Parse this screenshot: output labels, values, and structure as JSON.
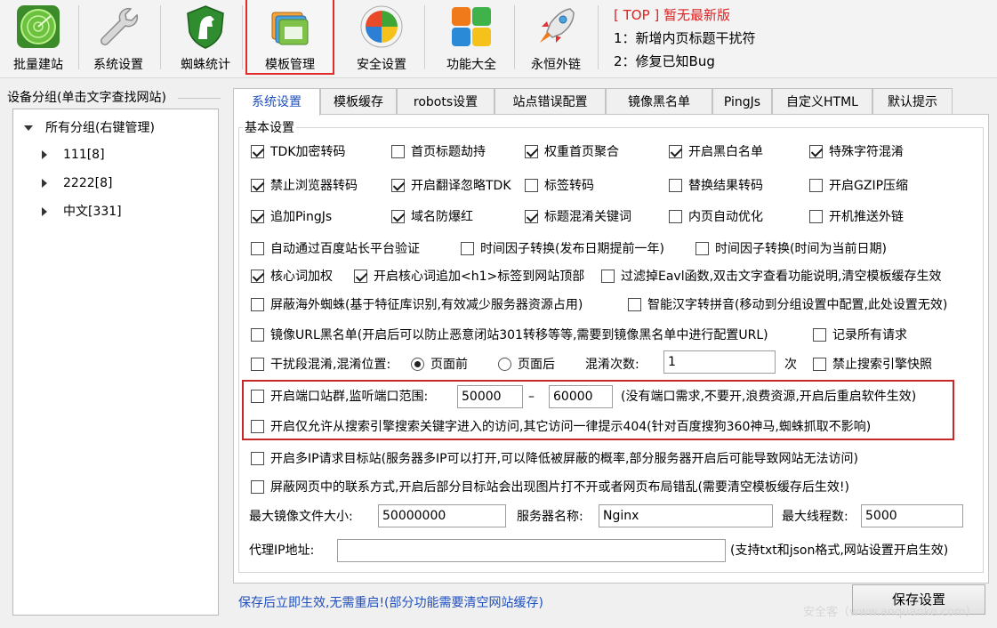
{
  "toolbar": {
    "items": [
      {
        "label": "批量建站",
        "icon": "radar-icon"
      },
      {
        "label": "系统设置",
        "icon": "wrench-icon"
      },
      {
        "label": "蜘蛛统计",
        "icon": "horse-shield-icon"
      },
      {
        "label": "模板管理",
        "icon": "folders-icon"
      },
      {
        "label": "安全设置",
        "icon": "windows-shield-icon"
      },
      {
        "label": "功能大全",
        "icon": "apps-grid-icon"
      },
      {
        "label": "永恒外链",
        "icon": "rocket-icon"
      }
    ],
    "active_index": 3
  },
  "notice": {
    "top": "[ TOP ] 暂无最新版",
    "line1": "1：新增内页标题干扰符",
    "line2": "2：修复已知Bug"
  },
  "groups": {
    "title": "设备分组(单击文字查找网站)",
    "root": "所有分组(右键管理)",
    "children": [
      "111[8]",
      "2222[8]",
      "中文[331]"
    ]
  },
  "tabs": [
    "系统设置",
    "模板缓存",
    "robots设置",
    "站点错误配置",
    "镜像黑名单",
    "PingJs",
    "自定义HTML",
    "默认提示"
  ],
  "active_tab": 0,
  "basic": {
    "legend": "基本设置",
    "row1": [
      {
        "label": "TDK加密转码",
        "checked": true
      },
      {
        "label": "首页标题劫持",
        "checked": false
      },
      {
        "label": "权重首页聚合",
        "checked": true
      },
      {
        "label": "开启黑白名单",
        "checked": true
      },
      {
        "label": "特殊字符混淆",
        "checked": true
      }
    ],
    "row2": [
      {
        "label": "禁止浏览器转码",
        "checked": true
      },
      {
        "label": "开启翻译忽略TDK",
        "checked": true
      },
      {
        "label": "标签转码",
        "checked": false
      },
      {
        "label": "替换结果转码",
        "checked": false
      },
      {
        "label": "开启GZIP压缩",
        "checked": false
      }
    ],
    "row3": [
      {
        "label": "追加PingJs",
        "checked": true
      },
      {
        "label": "域名防爆红",
        "checked": true
      },
      {
        "label": "标题混淆关键词",
        "checked": true
      },
      {
        "label": "内页自动优化",
        "checked": false
      },
      {
        "label": "开机推送外链",
        "checked": false
      }
    ],
    "row4": [
      {
        "label": "自动通过百度站长平台验证",
        "checked": false
      },
      {
        "label": "时间因子转换(发布日期提前一年)",
        "checked": false
      },
      {
        "label": "时间因子转换(时间为当前日期)",
        "checked": false
      }
    ],
    "row5": [
      {
        "label": "核心词加权",
        "checked": true
      },
      {
        "label": "开启核心词追加<h1>标签到网站顶部",
        "checked": true
      },
      {
        "label": "过滤掉Eavl函数,双击文字查看功能说明,清空模板缓存生效",
        "checked": false
      }
    ],
    "row6": [
      {
        "label": "屏蔽海外蜘蛛(基于特征库识别,有效减少服务器资源占用)",
        "checked": false
      },
      {
        "label": "智能汉字转拼音(移动到分组设置中配置,此处设置无效)",
        "checked": false
      }
    ],
    "row7": [
      {
        "label": "镜像URL黑名单(开启后可以防止恶意闭站301转移等等,需要到镜像黑名单中进行配置URL)",
        "checked": false
      },
      {
        "label": "记录所有请求",
        "checked": false
      }
    ],
    "row8": {
      "label": "干扰段混淆,混淆位置:",
      "checked": false,
      "radio_front": "页面前",
      "radio_back": "页面后",
      "selected": "页面前",
      "count_label": "混淆次数:",
      "count_value": "1",
      "count_unit": "次",
      "no_snapshot": "禁止搜索引擎快照",
      "no_snapshot_checked": false
    },
    "port": {
      "label": "开启端口站群,监听端口范围:",
      "checked": false,
      "from": "50000",
      "dash": "–",
      "to": "60000",
      "note": "(没有端口需求,不要开,浪费资源,开启后重启软件生效)"
    },
    "search_only": {
      "label": "开启仅允许从搜索引擎搜索关键字进入的访问,其它访问一律提示404(针对百度搜狗360神马,蜘蛛抓取不影响)",
      "checked": false
    },
    "multi_ip": {
      "label": "开启多IP请求目标站(服务器多IP可以打开,可以降低被屏蔽的概率,部分服务器开启后可能导致网站无法访问)",
      "checked": false
    },
    "hide_contact": {
      "label": "屏蔽网页中的联系方式,开启后部分目标站会出现图片打不开或者网页布局错乱(需要清空模板缓存后生效!)",
      "checked": false
    },
    "max_mirror_label": "最大镜像文件大小:",
    "max_mirror_value": "50000000",
    "server_name_label": "服务器名称:",
    "server_name_value": "Nginx",
    "max_threads_label": "最大线程数:",
    "max_threads_value": "5000",
    "proxy_label": "代理IP地址:",
    "proxy_value": "",
    "proxy_note": "(支持txt和json格式,网站设置开启生效)"
  },
  "footer": {
    "note": "保存后立即生效,无需重启!(部分功能需要清空网站缓存)",
    "save": "保存设置",
    "watermark": "安全客（www.anquanke.com）"
  },
  "colors": {
    "accent_blue": "#1f4fbf",
    "highlight_red": "#c62828",
    "notice_red": "#e02020"
  }
}
